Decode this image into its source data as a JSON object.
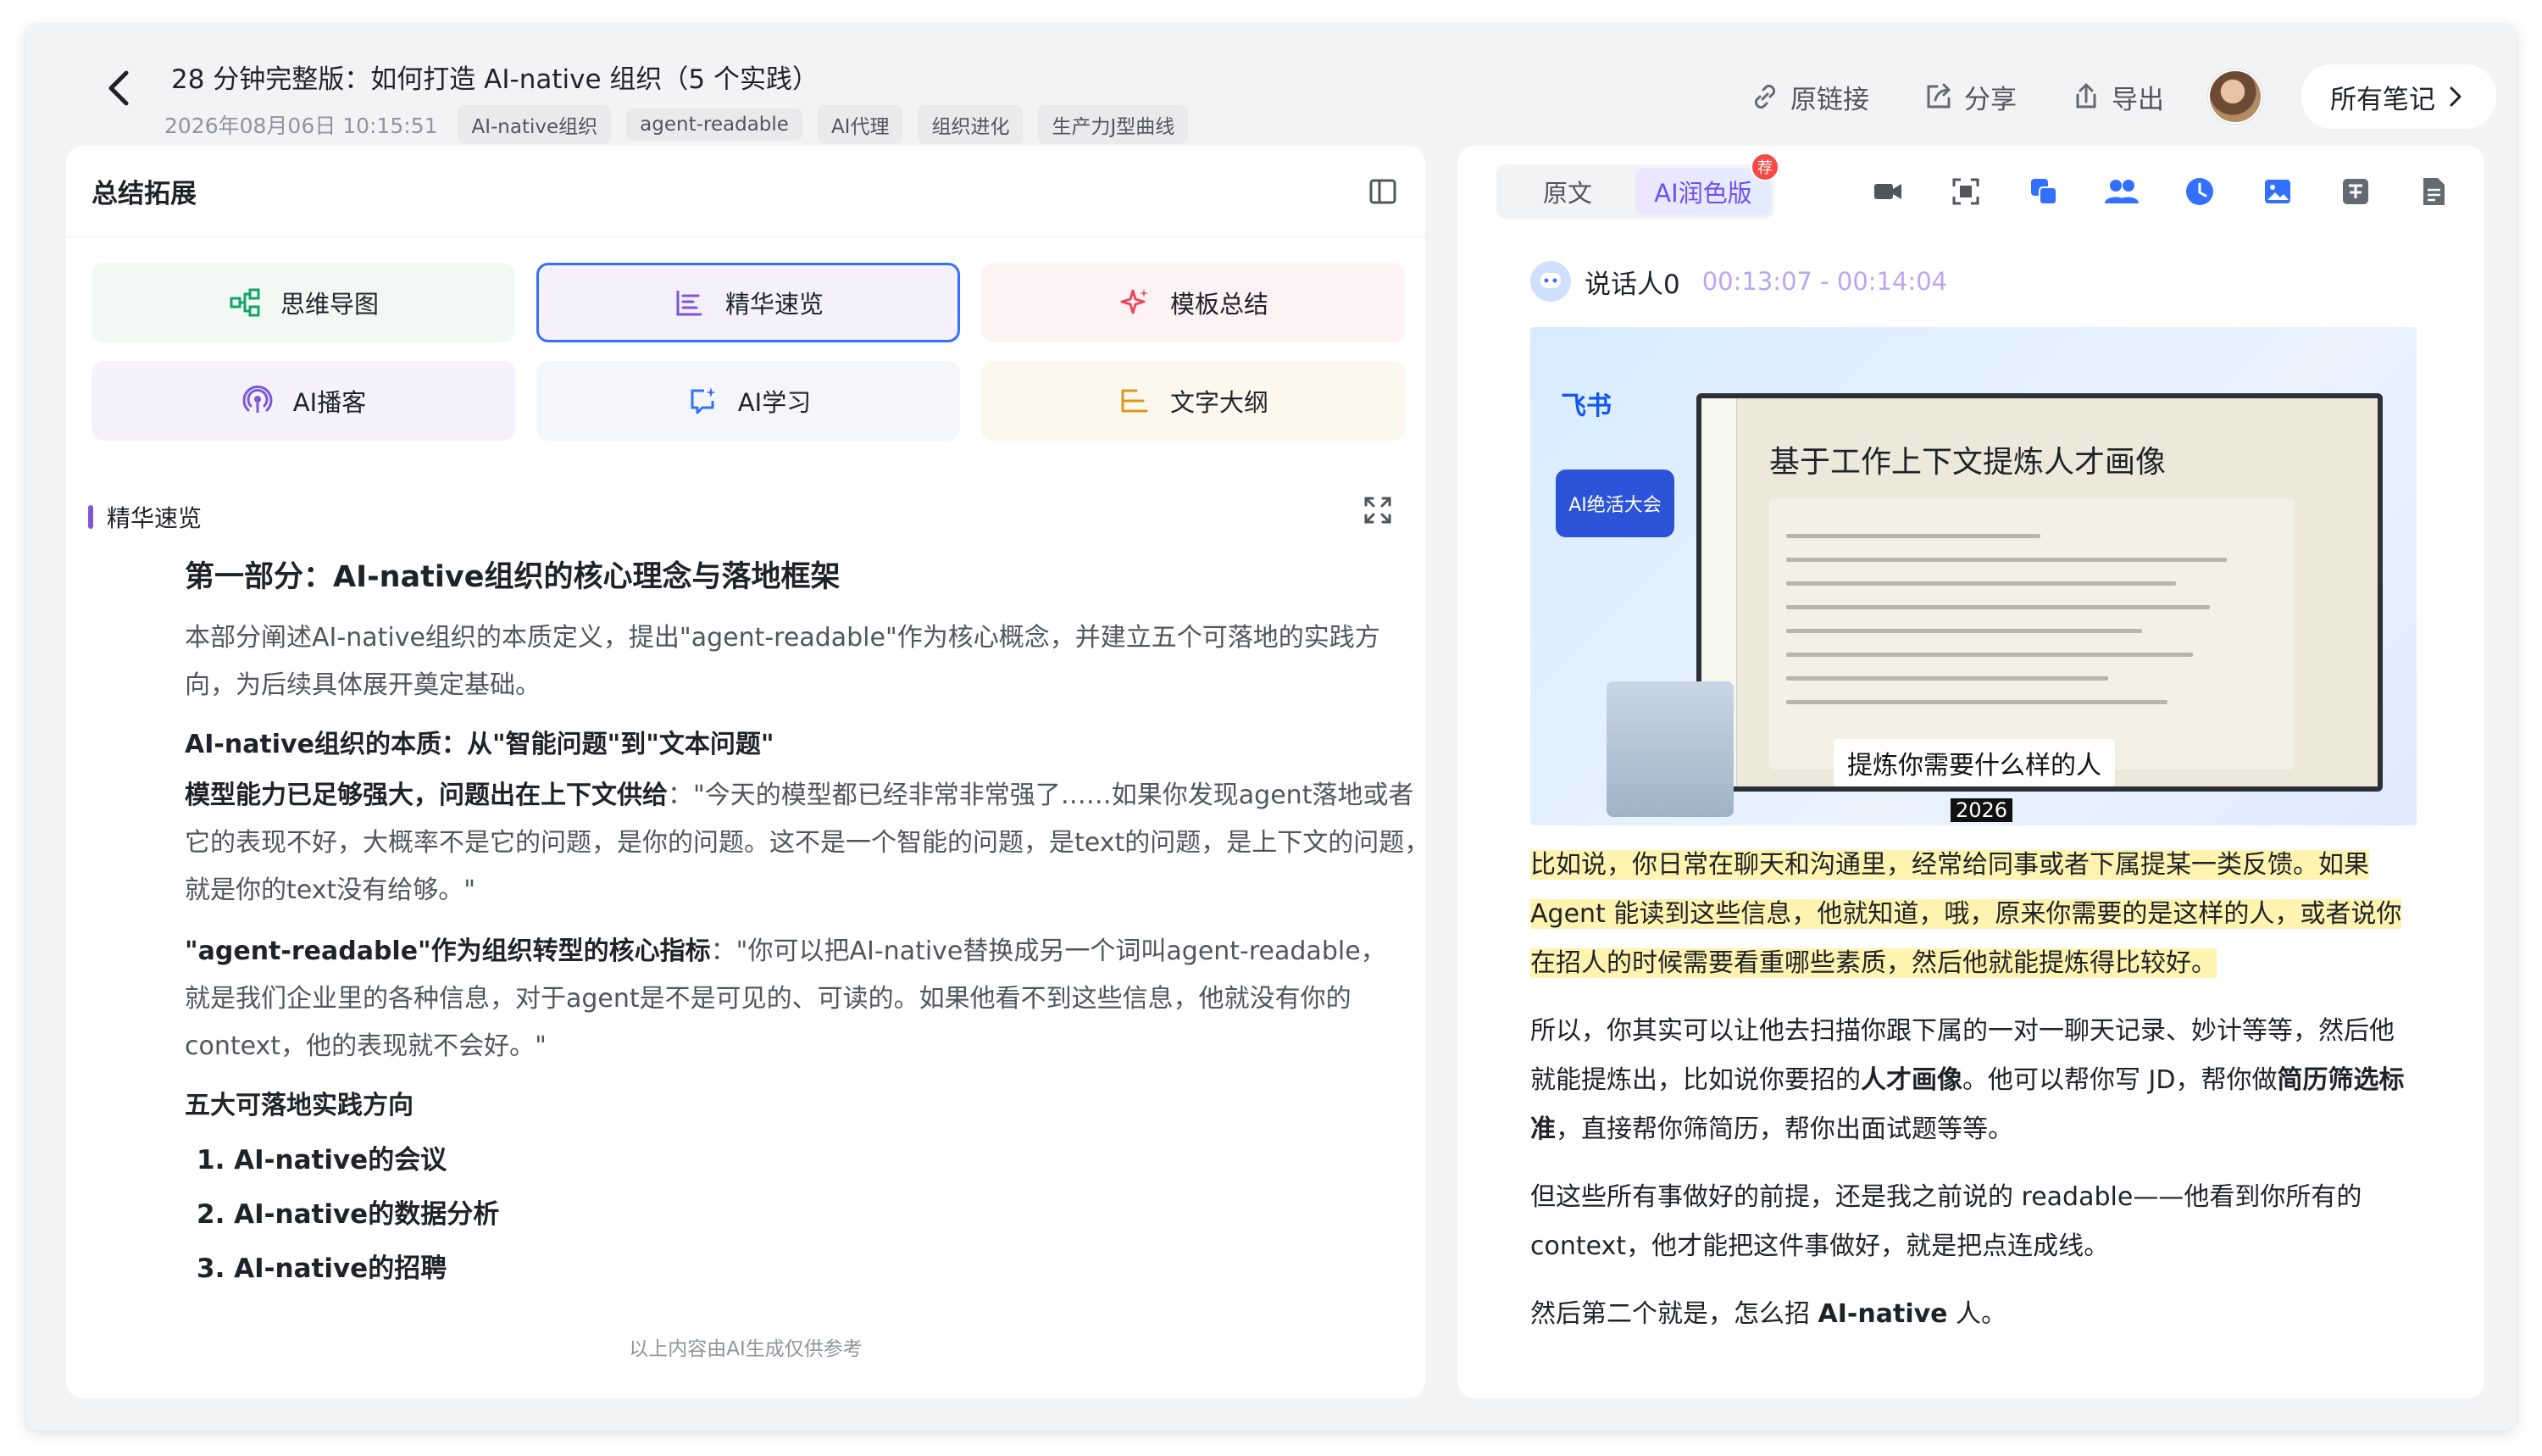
{
  "header": {
    "title": "28 分钟完整版：如何打造 AI-native 组织（5 个实践）",
    "date": "2026年08月06日 10:15:51",
    "tags": [
      "AI-native组织",
      "agent-readable",
      "AI代理",
      "组织进化",
      "生产力J型曲线"
    ],
    "actions": {
      "link": "原链接",
      "share": "分享",
      "export": "导出"
    },
    "all_notes": "所有笔记"
  },
  "left": {
    "title": "总结拓展",
    "tools": {
      "mindmap": "思维导图",
      "essence": "精华速览",
      "template": "模板总结",
      "podcast": "AI播客",
      "learn": "AI学习",
      "outline": "文字大纲"
    },
    "section_label": "精华速览",
    "heading": "第一部分：AI-native组织的核心理念与落地框架",
    "intro": "本部分阐述AI-native组织的本质定义，提出\"agent-readable\"作为核心概念，并建立五个可落地的实践方向，为后续具体展开奠定基础。",
    "sub1": "AI-native组织的本质：从\"智能问题\"到\"文本问题\"",
    "p1_bold": "模型能力已足够强大，问题出在上下文供给",
    "p1_text": "：\"今天的模型都已经非常非常强了……如果你发现agent落地或者它的表现不好，大概率不是它的问题，是你的问题。这不是一个智能的问题，是text的问题，是上下文的问题，就是你的text没有给够。\"",
    "p2_bold": "\"agent-readable\"作为组织转型的核心指标",
    "p2_text": "：\"你可以把AI-native替换成另一个词叫agent-readable，就是我们企业里的各种信息，对于agent是不是可见的、可读的。如果他看不到这些信息，他就没有你的context，他的表现就不会好。\"",
    "sub2": "五大可落地实践方向",
    "list": [
      "1. AI-native的会议",
      "2. AI-native的数据分析",
      "3. AI-native的招聘"
    ],
    "footnote": "以上内容由AI生成仅供参考"
  },
  "right": {
    "tabs": {
      "original": "原文",
      "polished": "AI润色版"
    },
    "badge": "荐",
    "speaker": "说话人0",
    "time": "00:13:07 - 00:14:04",
    "video": {
      "brand": "飞书",
      "event": "AI绝活大会",
      "slide_title": "基于工作上下文提炼人才画像",
      "caption": "提炼你需要什么样的人",
      "year": "2026"
    },
    "para1": "比如说，你日常在聊天和沟通里，经常给同事或者下属提某一类反馈。如果 Agent 能读到这些信息，他就知道，哦，原来你需要的是这样的人，或者说你在招人的时候需要看重哪些素质，然后他就能提炼得比较好。",
    "para2_a": "所以，你其实可以让他去扫描你跟下属的一对一聊天记录、妙计等等，然后他就能提炼出，比如说你要招的",
    "para2_b1": "人才画像",
    "para2_c": "。他可以帮你写 JD，帮你做",
    "para2_b2": "简历筛选标准",
    "para2_d": "，直接帮你筛简历，帮你出面试题等等。",
    "para3": "但这些所有事做好的前提，还是我之前说的 readable——他看到你所有的 context，他才能把这件事做好，就是把点连成线。",
    "para4_a": "然后第二个就是，怎么招 ",
    "para4_b": "AI-native",
    "para4_c": " 人。"
  }
}
